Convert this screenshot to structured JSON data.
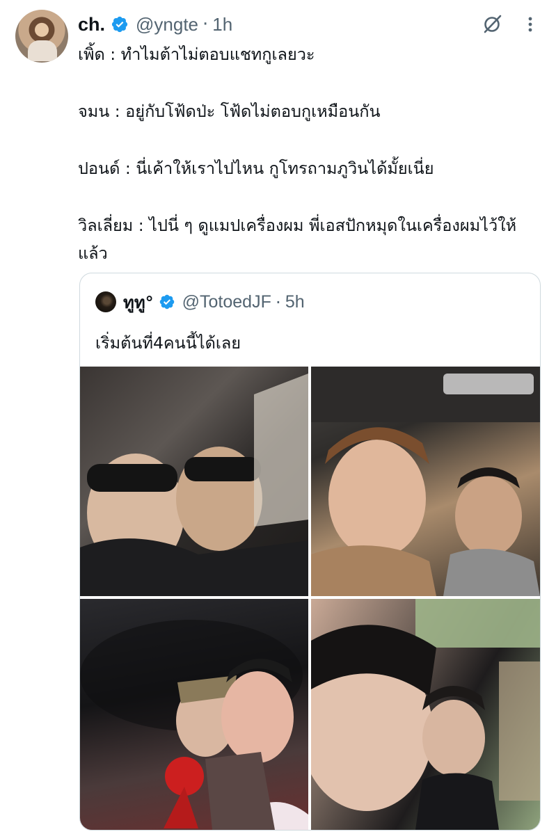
{
  "tweet": {
    "display_name": "ch.",
    "handle": "@yngte",
    "separator": "·",
    "time": "1h",
    "lines": [
      "เพิ้ด : ทำไมต้าไม่ตอบแชทกูเลยวะ",
      "จมน : อยู่กับโฟ้ดป่ะ โฟ้ดไม่ตอบกูเหมือนกัน",
      "ปอนด์ : นี่เค้าให้เราไปไหน กูโทรถามภูวินได้มั้ยเนี่ย",
      "วิลเลี่ยม : ไปนี่ ๆ ดูแมปเครื่องผม พี่เอสปักหมุดในเครื่องผมไว้ให้แล้ว"
    ]
  },
  "quoted_tweet": {
    "display_name": "ทูทู°",
    "handle": "@TotoedJF",
    "separator": "·",
    "time": "5h",
    "text": "เริ่มต้นที่4คนนี้ได้เลย",
    "photo_count": 4
  },
  "icons": {
    "verified": "verified-badge-icon",
    "grok": "grok-icon",
    "more": "more-options-icon"
  },
  "colors": {
    "text_primary": "#0f1419",
    "text_secondary": "#536471",
    "verified_blue": "#1d9bf0",
    "card_border": "#cfd9de"
  }
}
